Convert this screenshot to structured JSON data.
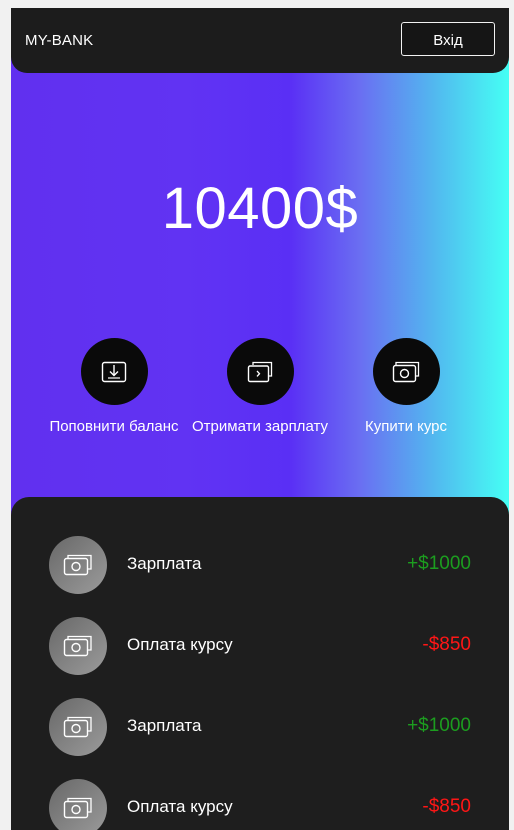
{
  "header": {
    "brand": "MY-BANK",
    "login_label": "Вхід"
  },
  "balance": {
    "amount": "10400$"
  },
  "actions": [
    {
      "label": "Поповнити баланс",
      "icon": "deposit-icon"
    },
    {
      "label": "Отримати зарплату",
      "icon": "wallet-icon"
    },
    {
      "label": "Купити курс",
      "icon": "cash-icon"
    }
  ],
  "transactions": [
    {
      "title": "Зарплата",
      "amount": "+$1000",
      "kind": "income"
    },
    {
      "title": "Оплата курсу",
      "amount": "-$850",
      "kind": "expense"
    },
    {
      "title": "Зарплата",
      "amount": "+$1000",
      "kind": "income"
    },
    {
      "title": "Оплата курсу",
      "amount": "-$850",
      "kind": "expense"
    }
  ],
  "colors": {
    "income": "#1c9d1f",
    "expense": "#ff1616",
    "gradient_start": "#6130ef",
    "gradient_end": "#45fff4",
    "panel": "#1e1e1e"
  }
}
